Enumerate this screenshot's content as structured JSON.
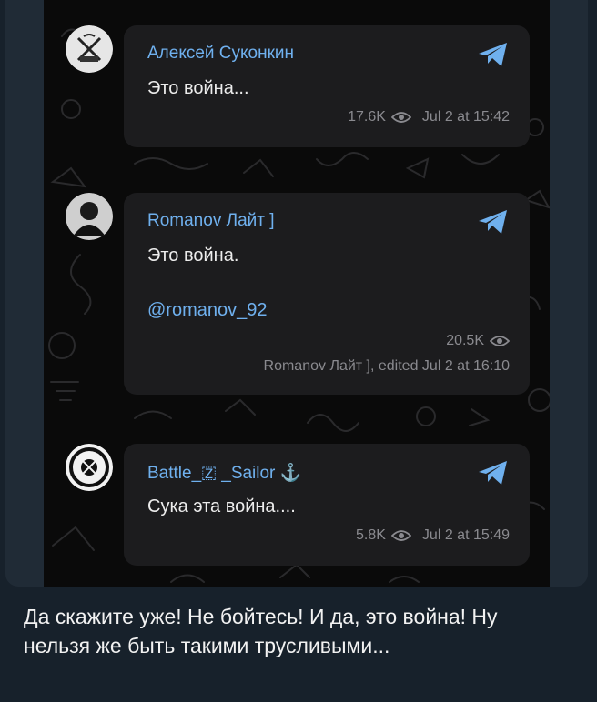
{
  "messages": [
    {
      "author": "Алексей Суконкин",
      "text": "Это война...",
      "views": "17.6K",
      "date": "Jul 2 at 15:42"
    },
    {
      "author": "Romanov Лайт ]",
      "text": "Это война.",
      "link": "@romanov_92",
      "views": "20.5K",
      "edited_line": "Romanov Лайт ], edited  Jul 2 at 16:10"
    },
    {
      "author": "Battle_🇿 _Sailor ⚓",
      "text": "Сука эта война....",
      "views": "5.8K",
      "date": "Jul 2 at 15:49"
    }
  ],
  "caption": "Да скажите уже! Не бойтесь! И да, это война! Ну нельзя же быть такими трусливыми...",
  "colors": {
    "background": "#17212b",
    "bubble": "#1c1c1e",
    "accent": "#6fb0ee",
    "meta": "#8a8a8f"
  },
  "icons": [
    "telegram-plane-icon",
    "eye-icon"
  ]
}
